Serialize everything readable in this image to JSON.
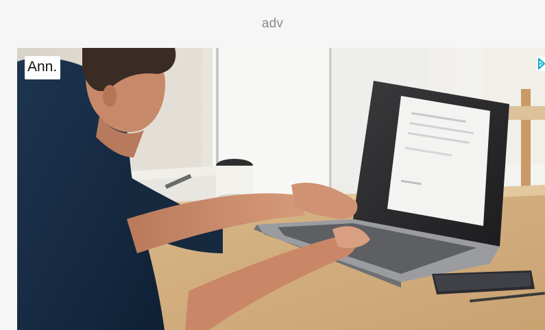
{
  "header": {
    "label": "adv"
  },
  "ad": {
    "badge_label": "Ann.",
    "image_subject": "man-typing-on-laptop-photo",
    "adchoices_icon": "adchoices-icon",
    "accent_color": "#00aecd"
  }
}
